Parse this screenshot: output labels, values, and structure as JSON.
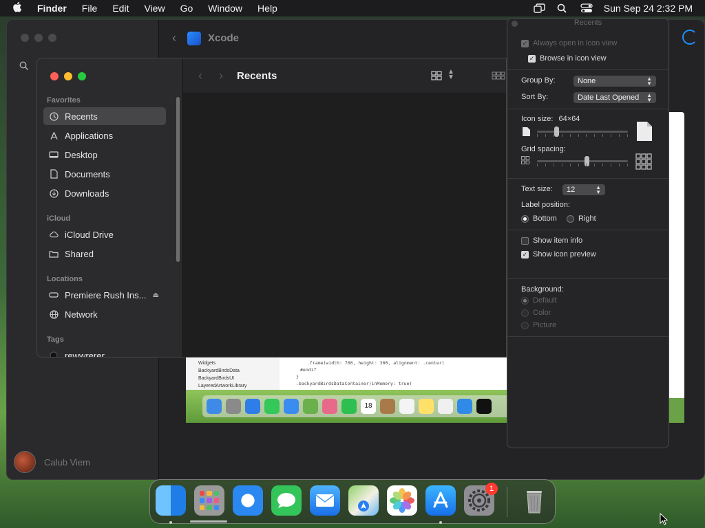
{
  "menubar": {
    "app_name": "Finder",
    "items": [
      "File",
      "Edit",
      "View",
      "Go",
      "Window",
      "Help"
    ],
    "clock": "Sun Sep 24  2:32 PM"
  },
  "xcode": {
    "title": "Xcode",
    "user_name": "Calub Viem"
  },
  "finder": {
    "title": "Recents",
    "sections": {
      "favorites": "Favorites",
      "icloud": "iCloud",
      "locations": "Locations",
      "tags": "Tags"
    },
    "favorites": [
      {
        "label": "Recents",
        "icon": "clock-icon"
      },
      {
        "label": "Applications",
        "icon": "applications-icon"
      },
      {
        "label": "Desktop",
        "icon": "desktop-icon"
      },
      {
        "label": "Documents",
        "icon": "document-icon"
      },
      {
        "label": "Downloads",
        "icon": "download-icon"
      }
    ],
    "icloud": [
      {
        "label": "iCloud Drive",
        "icon": "cloud-icon"
      },
      {
        "label": "Shared",
        "icon": "shared-folder-icon"
      }
    ],
    "locations": [
      {
        "label": "Premiere Rush Ins...",
        "icon": "drive-icon"
      },
      {
        "label": "Network",
        "icon": "globe-icon"
      }
    ],
    "tags": [
      {
        "label": "rewwrerer",
        "color": "#111111"
      }
    ]
  },
  "view_options": {
    "title": "Recents",
    "always_open": "Always open in icon view",
    "browse_icon": "Browse in icon view",
    "group_by_label": "Group By:",
    "group_by_value": "None",
    "sort_by_label": "Sort By:",
    "sort_by_value": "Date Last Opened",
    "icon_size_label": "Icon size:",
    "icon_size_value": "64×64",
    "grid_spacing_label": "Grid spacing:",
    "text_size_label": "Text size:",
    "text_size_value": "12",
    "label_position_label": "Label position:",
    "label_bottom": "Bottom",
    "label_right": "Right",
    "show_item_info": "Show item info",
    "show_icon_preview": "Show icon preview",
    "background_label": "Background:",
    "bg_default": "Default",
    "bg_color": "Color",
    "bg_picture": "Picture",
    "icon_size_level": 0.2,
    "grid_spacing_level": 0.55
  },
  "preview": {
    "tree": [
      "Widgets",
      "BackyardBirdsData",
      "BackyardBirdsUI",
      "LayeredArtworkLibrary"
    ],
    "code": [
      ".frame(width: 700, height: 300, alignment: .center)",
      "#endif",
      "}",
      ".backyardBirdsDataContainer(inMemory: true)"
    ],
    "calendar_day": "18"
  },
  "dock": {
    "apps": [
      "finder-icon",
      "launchpad-icon",
      "safari-icon",
      "messages-icon",
      "mail-icon",
      "maps-icon",
      "photos-icon",
      "app-store-icon",
      "system-settings-icon",
      "trash-icon"
    ],
    "settings_badge": "1"
  }
}
